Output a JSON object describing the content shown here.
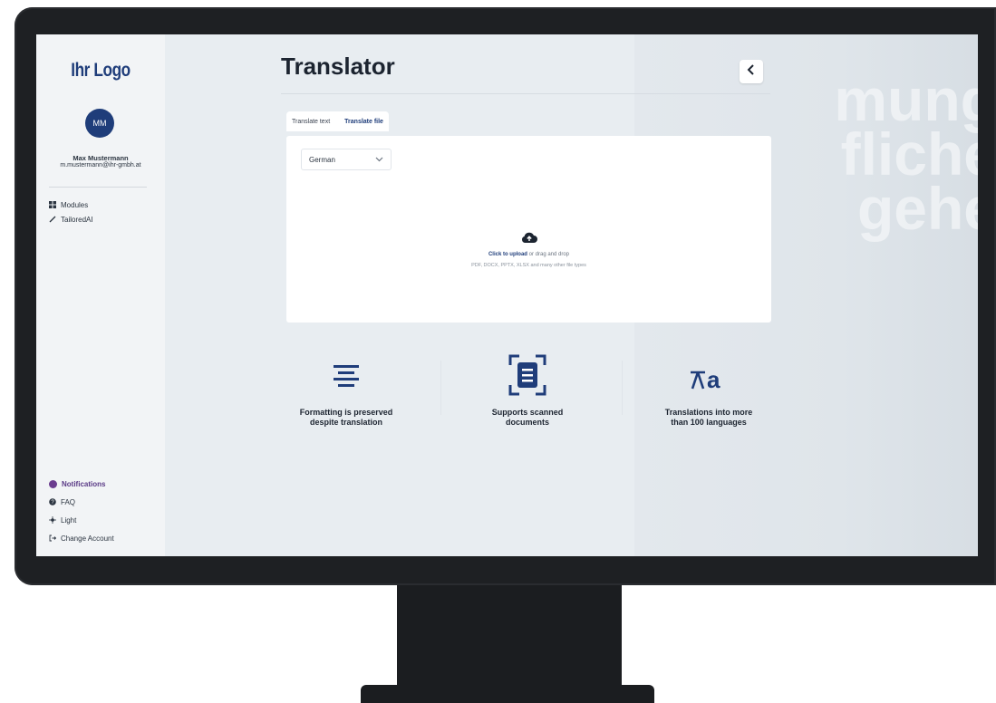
{
  "sidebar": {
    "logo": "Ihr Logo",
    "avatar_initials": "MM",
    "user_name": "Max Mustermann",
    "user_email": "m.mustermann@ihr-gmbh.at",
    "nav": [
      {
        "label": "Modules",
        "icon": "grid-icon"
      },
      {
        "label": "TailoredAI",
        "icon": "pencil-icon"
      }
    ],
    "bottom": [
      {
        "label": "Notifications",
        "icon": "notification-dot-icon"
      },
      {
        "label": "FAQ",
        "icon": "help-icon"
      },
      {
        "label": "Light",
        "icon": "sun-icon"
      },
      {
        "label": "Change Account",
        "icon": "logout-icon"
      }
    ]
  },
  "main": {
    "title": "Translator",
    "back_button_icon": "chevron-left-icon",
    "tabs": [
      {
        "label": "Translate text",
        "active": false
      },
      {
        "label": "Translate file",
        "active": true
      }
    ],
    "language_select": {
      "value": "German"
    },
    "upload": {
      "link_text": "Click to upload",
      "rest_text": "or drag and drop",
      "sub_text": "PDF, DOCX, PPTX, XLSX and many other file types"
    },
    "features": [
      {
        "icon": "align-center-icon",
        "line1": "Formatting is preserved",
        "line2": "despite translation"
      },
      {
        "icon": "scan-document-icon",
        "line1": "Supports scanned",
        "line2": "documents"
      },
      {
        "icon": "translate-icon",
        "line1": "Translations into more",
        "line2": "than 100 languages"
      }
    ]
  },
  "colors": {
    "brand": "#1f3d7a",
    "notification": "#6b3d8f",
    "monitor": "#1e2023"
  }
}
